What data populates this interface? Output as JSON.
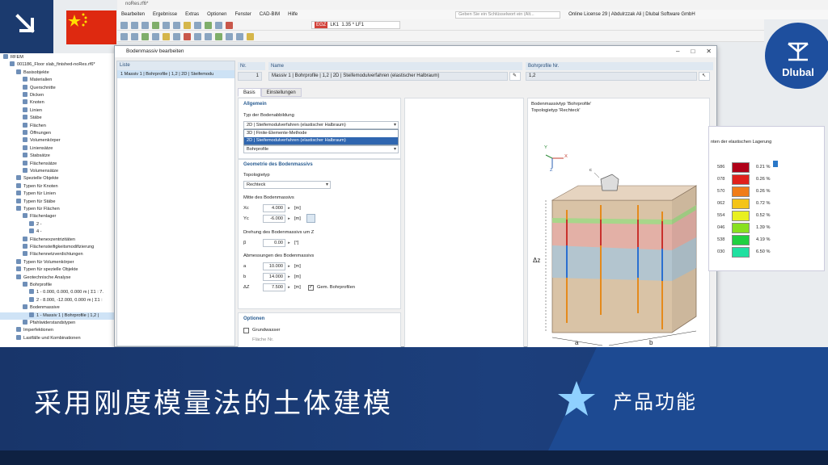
{
  "app": {
    "doc_title": "noRes.rf6*",
    "menu": [
      "Bearbeiten",
      "Ergebnisse",
      "Extras",
      "Optionen",
      "Fenster",
      "CAD-BIM",
      "Hilfe"
    ],
    "search_placeholder": "Geben Sie ein Schlüsselwort ein (Alt...",
    "license": "Online License 29 | Abdulrzzak Ali | Dlubal Software GmbH",
    "load_case_tag": "EGZ",
    "load_case": "LK1",
    "load_factor": "1.35 * LF1"
  },
  "navigator": {
    "rows": [
      {
        "label": "RFEM",
        "indent": 0
      },
      {
        "label": "001186_Floor slab_finished-noRes.rf6*",
        "indent": 1
      },
      {
        "label": "Basisobjekte",
        "indent": 2
      },
      {
        "label": "Materialien",
        "indent": 3
      },
      {
        "label": "Querschnitte",
        "indent": 3
      },
      {
        "label": "Dicken",
        "indent": 3
      },
      {
        "label": "Knoten",
        "indent": 3
      },
      {
        "label": "Linien",
        "indent": 3
      },
      {
        "label": "Stäbe",
        "indent": 3
      },
      {
        "label": "Flächen",
        "indent": 3
      },
      {
        "label": "Öffnungen",
        "indent": 3
      },
      {
        "label": "Volumenkörper",
        "indent": 3
      },
      {
        "label": "Liniensätze",
        "indent": 3
      },
      {
        "label": "Stabsätze",
        "indent": 3
      },
      {
        "label": "Flächensätze",
        "indent": 3
      },
      {
        "label": "Volumensätze",
        "indent": 3
      },
      {
        "label": "Spezielle Objekte",
        "indent": 2
      },
      {
        "label": "Typen für Knoten",
        "indent": 2
      },
      {
        "label": "Typen für Linien",
        "indent": 2
      },
      {
        "label": "Typen für Stäbe",
        "indent": 2
      },
      {
        "label": "Typen für Flächen",
        "indent": 2
      },
      {
        "label": "Flächenlager",
        "indent": 3
      },
      {
        "label": "2 -",
        "indent": 4
      },
      {
        "label": "4 -",
        "indent": 4
      },
      {
        "label": "Flächenexzentrizitäten",
        "indent": 3
      },
      {
        "label": "Flächensteifigkeitsmodifizierung",
        "indent": 3
      },
      {
        "label": "Flächennetzverdichtungen",
        "indent": 3
      },
      {
        "label": "Typen für Volumenkörper",
        "indent": 2
      },
      {
        "label": "Typen für spezielle Objekte",
        "indent": 2
      },
      {
        "label": "Geotechnische Analyse",
        "indent": 2
      },
      {
        "label": "Bohrprofile",
        "indent": 3
      },
      {
        "label": "1 - 0.000, 0.000, 0.000 m | Σ1 : 7.",
        "indent": 4
      },
      {
        "label": "2 - 8.000, -12.000, 0.000 m | Σ1 :",
        "indent": 4
      },
      {
        "label": "Bodenmassive",
        "indent": 3
      },
      {
        "label": "1 - Massiv 1 | Bohrprofile | 1,2 |",
        "indent": 4,
        "selected": true
      },
      {
        "label": "Pfahlwiderstandstypen",
        "indent": 3
      },
      {
        "label": "Imperfektionen",
        "indent": 2
      },
      {
        "label": "Lastfälle und Kombinationen",
        "indent": 2
      }
    ]
  },
  "dialog": {
    "title": "Bodenmassiv bearbeiten",
    "list_header": "Liste",
    "list_item": "1  Massiv 1 | Bohrprofile | 1,2 | 2D | Steifemodu",
    "no_label": "Nr.",
    "no_value": "1",
    "name_label": "Name",
    "name_value": "Massiv 1 | Bohrprofile | 1,2 | 2D | Steifemodulverfahren (elastischer Halbraum)",
    "boreholes_label": "Bohrprofile Nr.",
    "boreholes_value": "1,2",
    "tabs": [
      "Basis",
      "Einstellungen"
    ],
    "general": {
      "section": "Allgemein",
      "soil_model_label": "Typ der Bodenabbildung",
      "soil_model_value": "2D | Steifemodulverfahren (elastischer Halbraum)",
      "options": [
        "3D | Finite-Elemente-Methode",
        "2D | Steifemodulverfahren (elastischer Halbraum)"
      ],
      "assign_value": "Bohrprofile"
    },
    "geometry": {
      "section": "Geometrie des Bodenmassivs",
      "topology_label": "Topologietyp",
      "topology_value": "Rechteck",
      "center_label": "Mitte des Bodenmassivs",
      "xc_label": "Xc",
      "xc_value": "4.000",
      "yc_label": "Yc",
      "yc_value": "-6.000",
      "unit_m": "[m]",
      "rotation_label": "Drehung des Bodenmassivs um Z",
      "beta_label": "β",
      "beta_value": "0.00",
      "unit_deg": "[°]",
      "dims_label": "Abmessungen des Bodenmassivs",
      "a_label": "a",
      "a_value": "10.000",
      "b_label": "b",
      "b_value": "14.000",
      "dz_label": "ΔZ",
      "dz_value": "7.500",
      "acc_borehole_label": "Gem. Bohrprofilen"
    },
    "options": {
      "section": "Optionen",
      "groundwater_label": "Grundwasser",
      "surface_no_label": "Fläche Nr."
    },
    "preview": {
      "type_line1": "Bodenmassivtyp 'Bohrprofile'",
      "type_line2": "Topologietyp 'Rechteck'",
      "axis_x": "X",
      "axis_y": "Y",
      "axis_z": "Z",
      "label_c": "c",
      "label_dz": "Δz",
      "label_a": "a",
      "label_b": "b"
    }
  },
  "legend_panel": {
    "title": "nten der elastischen Lagerung",
    "rows": [
      {
        "value": "586",
        "color": "#b00018",
        "pct": "0.21 %"
      },
      {
        "value": "078",
        "color": "#e0201c",
        "pct": "0.26 %"
      },
      {
        "value": "570",
        "color": "#f07c18",
        "pct": "0.26 %"
      },
      {
        "value": "062",
        "color": "#f4c418",
        "pct": "0.72 %"
      },
      {
        "value": "554",
        "color": "#e8f020",
        "pct": "0.52 %"
      },
      {
        "value": "046",
        "color": "#88e020",
        "pct": "1.39 %"
      },
      {
        "value": "538",
        "color": "#20d040",
        "pct": "4.19 %"
      },
      {
        "value": "030",
        "color": "#20e0a0",
        "pct": "6.50 %"
      }
    ]
  },
  "brand": {
    "logo_text": "Dlubal"
  },
  "banner": {
    "title": "采用刚度模量法的土体建模",
    "feature": "产品功能"
  }
}
